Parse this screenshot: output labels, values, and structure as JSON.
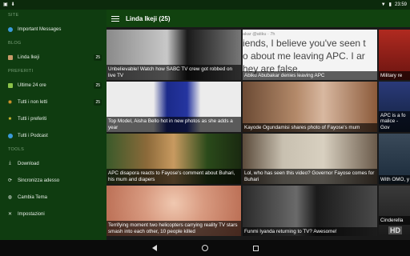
{
  "status": {
    "time": "23:59"
  },
  "drawer": {
    "sections": {
      "site": "SITE",
      "blog": "BLOG",
      "prefs": "PREFERITI",
      "tools": "TOOLS"
    },
    "site_item": "Important Messages",
    "blog_item": {
      "label": "Linda Ikeji",
      "count": "25"
    },
    "pref_items": [
      {
        "label": "Ultime 24 ore",
        "count": "25"
      },
      {
        "label": "Tutti i non letti",
        "count": "25"
      },
      {
        "label": "Tutti i preferiti",
        "count": ""
      },
      {
        "label": "Tutti i Podcast",
        "count": ""
      }
    ],
    "tool_items": [
      {
        "label": "Download"
      },
      {
        "label": "Sincronizza adesso"
      },
      {
        "label": "Cambia Tema"
      },
      {
        "label": "Impostazioni"
      }
    ]
  },
  "appbar": {
    "title": "Linda Ikeji (25)"
  },
  "tiles": [
    {
      "caption": "Unbelievable! Watch how SABC TV crew got robbed on live TV"
    },
    {
      "caption": "Abiku Abubakar denies leaving APC",
      "overlay_handle": "akar @atiku · 7h",
      "overlay_line1": "iends, I believe you've seen t",
      "overlay_line2": "o about me leaving APC. I ar",
      "overlay_line3": "hey are false."
    },
    {
      "caption": "Military re"
    },
    {
      "caption": "Top Model, Aisha Bello hot in new photos as she adds a year"
    },
    {
      "caption": "Kayode Ogundamisi shares photo of Fayose's mum"
    },
    {
      "caption": "APC is a fo malice - Gov"
    },
    {
      "caption": "APC disapora reacts to Fayose's comment about Buhari, his mum and diapers"
    },
    {
      "caption": "Lol, who has seen this video? Governor Fayose comes for Buhari"
    },
    {
      "caption": "With OMO, y"
    },
    {
      "caption": "Terrifying moment two helicopters carrying reality TV stars smash into each other, 10 people killed"
    },
    {
      "caption": "Funmi Iyanda returning to TV? Awesome!"
    },
    {
      "caption": "Cinderella"
    }
  ],
  "tile_badge": "HD",
  "colors": {
    "drawer_bg": "#0f3c10",
    "appbar_bg": "#11420f",
    "statusbar_bg": "#0c2a0c"
  }
}
